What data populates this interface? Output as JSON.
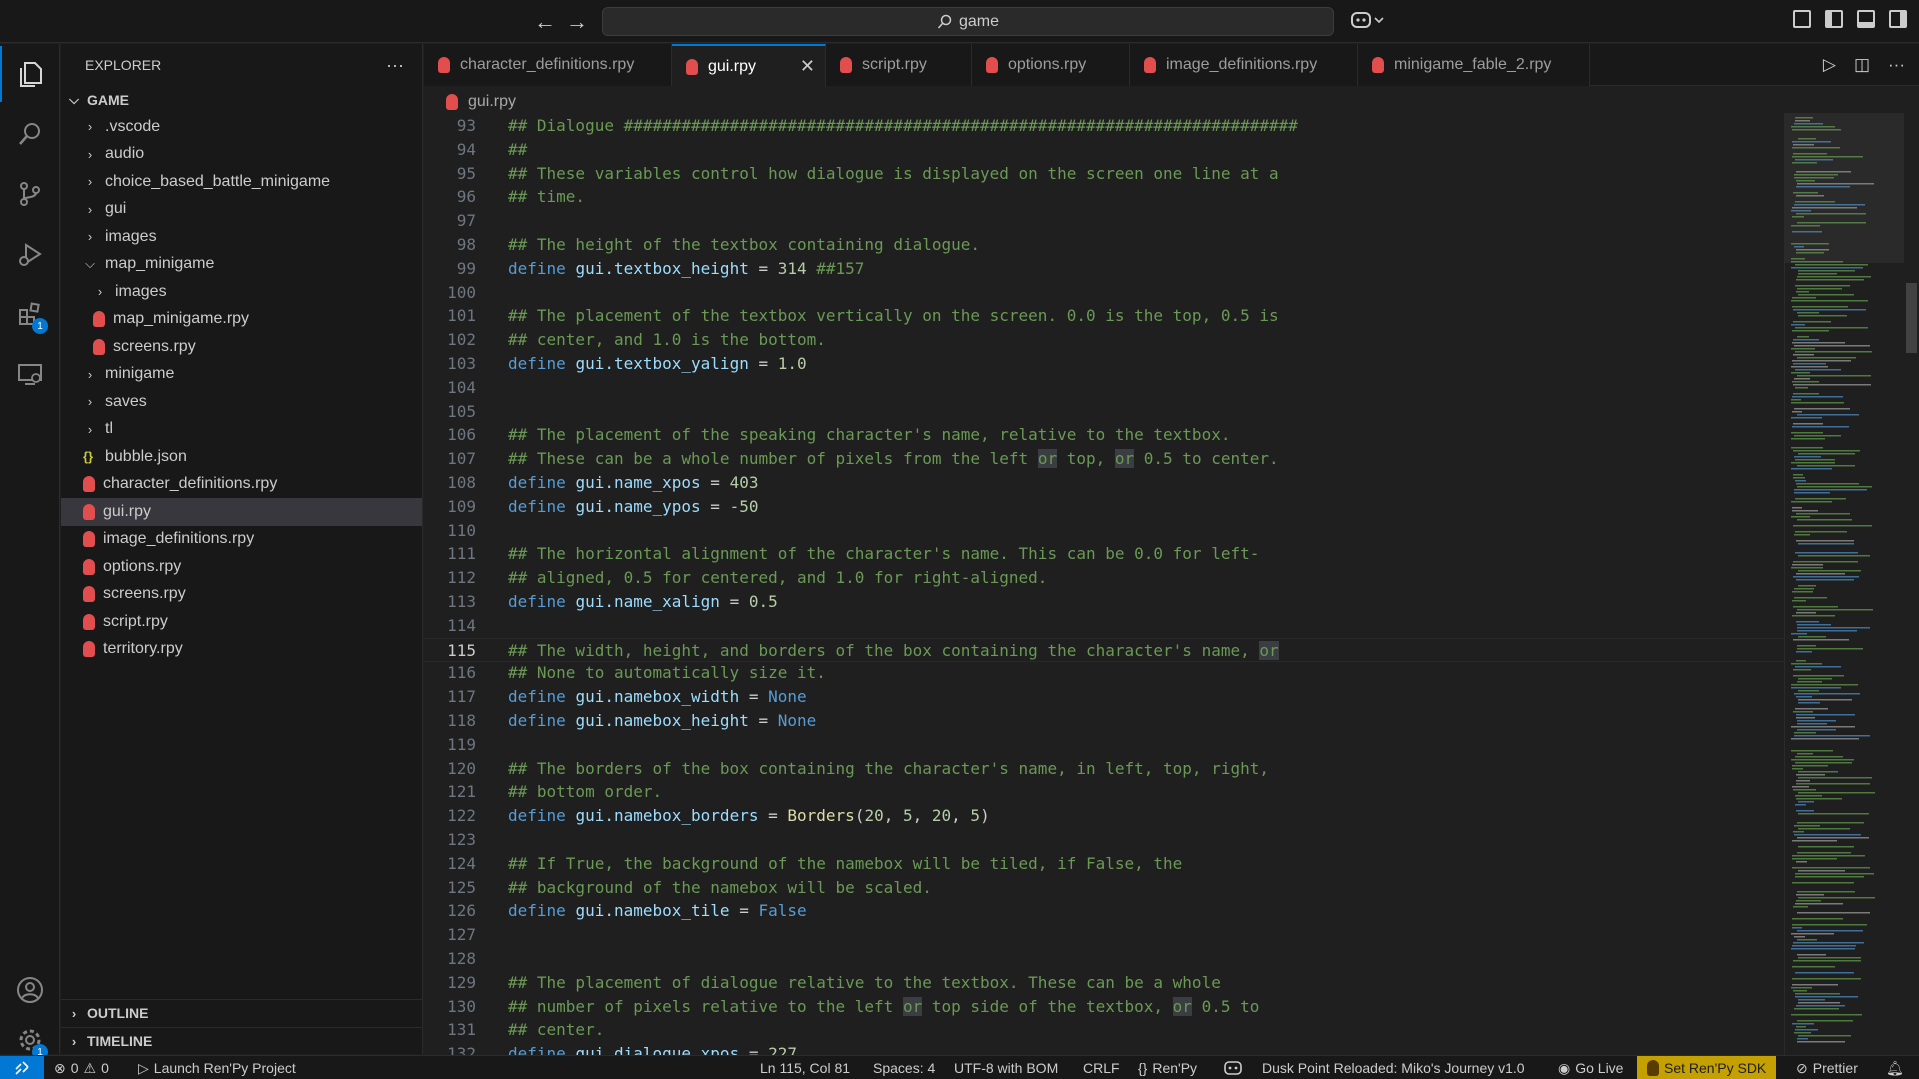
{
  "titlebar": {
    "back": "←",
    "forward": "→",
    "search_text": "game"
  },
  "explorer": {
    "title": "EXPLORER",
    "more": "···",
    "root": "GAME",
    "items": [
      {
        "label": ".vscode",
        "type": "folder",
        "open": false,
        "depth": 1
      },
      {
        "label": "audio",
        "type": "folder",
        "open": false,
        "depth": 1
      },
      {
        "label": "choice_based_battle_minigame",
        "type": "folder",
        "open": false,
        "depth": 1
      },
      {
        "label": "gui",
        "type": "folder",
        "open": false,
        "depth": 1
      },
      {
        "label": "images",
        "type": "folder",
        "open": false,
        "depth": 1
      },
      {
        "label": "map_minigame",
        "type": "folder",
        "open": true,
        "depth": 1
      },
      {
        "label": "images",
        "type": "folder",
        "open": false,
        "depth": 2
      },
      {
        "label": "map_minigame.rpy",
        "type": "rpy",
        "depth": 2
      },
      {
        "label": "screens.rpy",
        "type": "rpy",
        "depth": 2
      },
      {
        "label": "minigame",
        "type": "folder",
        "open": false,
        "depth": 1
      },
      {
        "label": "saves",
        "type": "folder",
        "open": false,
        "depth": 1
      },
      {
        "label": "tl",
        "type": "folder",
        "open": false,
        "depth": 1
      },
      {
        "label": "bubble.json",
        "type": "json",
        "depth": 1
      },
      {
        "label": "character_definitions.rpy",
        "type": "rpy",
        "depth": 1
      },
      {
        "label": "gui.rpy",
        "type": "rpy",
        "depth": 1,
        "selected": true
      },
      {
        "label": "image_definitions.rpy",
        "type": "rpy",
        "depth": 1
      },
      {
        "label": "options.rpy",
        "type": "rpy",
        "depth": 1
      },
      {
        "label": "screens.rpy",
        "type": "rpy",
        "depth": 1
      },
      {
        "label": "script.rpy",
        "type": "rpy",
        "depth": 1
      },
      {
        "label": "territory.rpy",
        "type": "rpy",
        "depth": 1
      }
    ],
    "outline": "OUTLINE",
    "timeline": "TIMELINE"
  },
  "activity": {
    "extensions_badge": "1",
    "settings_badge": "1"
  },
  "tabs": [
    {
      "label": "character_definitions.rpy",
      "active": false
    },
    {
      "label": "gui.rpy",
      "active": true
    },
    {
      "label": "script.rpy",
      "active": false
    },
    {
      "label": "options.rpy",
      "active": false
    },
    {
      "label": "image_definitions.rpy",
      "active": false
    },
    {
      "label": "minigame_fable_2.rpy",
      "active": false
    }
  ],
  "tab_close": "✕",
  "breadcrumb": "gui.rpy",
  "editor": {
    "current_line": 115,
    "lines": [
      {
        "n": 93,
        "segs": [
          [
            "cm",
            "## Dialogue ######################################################################"
          ]
        ]
      },
      {
        "n": 94,
        "segs": [
          [
            "cm",
            "##"
          ]
        ]
      },
      {
        "n": 95,
        "segs": [
          [
            "cm",
            "## These variables control how dialogue is displayed on the screen one line at a"
          ]
        ]
      },
      {
        "n": 96,
        "segs": [
          [
            "cm",
            "## time."
          ]
        ]
      },
      {
        "n": 97,
        "segs": []
      },
      {
        "n": 98,
        "segs": [
          [
            "cm",
            "## The height of the textbox containing dialogue."
          ]
        ]
      },
      {
        "n": 99,
        "segs": [
          [
            "kw",
            "define "
          ],
          [
            "id",
            "gui.textbox_height"
          ],
          [
            "",
            " = "
          ],
          [
            "nm",
            "314"
          ],
          [
            "cm",
            " ##157"
          ]
        ]
      },
      {
        "n": 100,
        "segs": []
      },
      {
        "n": 101,
        "segs": [
          [
            "cm",
            "## The placement of the textbox vertically on the screen. 0.0 is the top, 0.5 is"
          ]
        ]
      },
      {
        "n": 102,
        "segs": [
          [
            "cm",
            "## center, and 1.0 is the bottom."
          ]
        ]
      },
      {
        "n": 103,
        "segs": [
          [
            "kw",
            "define "
          ],
          [
            "id",
            "gui.textbox_yalign"
          ],
          [
            "",
            " = "
          ],
          [
            "nm",
            "1.0"
          ]
        ]
      },
      {
        "n": 104,
        "segs": []
      },
      {
        "n": 105,
        "segs": []
      },
      {
        "n": 106,
        "segs": [
          [
            "cm",
            "## The placement of the speaking character's name, relative to the textbox."
          ]
        ]
      },
      {
        "n": 107,
        "segs": [
          [
            "cm",
            "## These can be a whole number of pixels from the left "
          ],
          [
            "cm hl",
            "or"
          ],
          [
            "cm",
            " top, "
          ],
          [
            "cm hl",
            "or"
          ],
          [
            "cm",
            " 0.5 to center."
          ]
        ]
      },
      {
        "n": 108,
        "segs": [
          [
            "kw",
            "define "
          ],
          [
            "id",
            "gui.name_xpos"
          ],
          [
            "",
            " = "
          ],
          [
            "nm",
            "403"
          ]
        ]
      },
      {
        "n": 109,
        "segs": [
          [
            "kw",
            "define "
          ],
          [
            "id",
            "gui.name_ypos"
          ],
          [
            "",
            " = "
          ],
          [
            "nm",
            "-50"
          ]
        ]
      },
      {
        "n": 110,
        "segs": []
      },
      {
        "n": 111,
        "segs": [
          [
            "cm",
            "## The horizontal alignment of the character's name. This can be 0.0 for left-"
          ]
        ]
      },
      {
        "n": 112,
        "segs": [
          [
            "cm",
            "## aligned, 0.5 for centered, and 1.0 for right-aligned."
          ]
        ]
      },
      {
        "n": 113,
        "segs": [
          [
            "kw",
            "define "
          ],
          [
            "id",
            "gui.name_xalign"
          ],
          [
            "",
            " = "
          ],
          [
            "nm",
            "0.5"
          ]
        ]
      },
      {
        "n": 114,
        "segs": []
      },
      {
        "n": 115,
        "segs": [
          [
            "cm",
            "## The width, height, and borders of the box containing the character's name, "
          ],
          [
            "cm hl",
            "or"
          ]
        ]
      },
      {
        "n": 116,
        "segs": [
          [
            "cm",
            "## None to automatically size it."
          ]
        ]
      },
      {
        "n": 117,
        "segs": [
          [
            "kw",
            "define "
          ],
          [
            "id",
            "gui.namebox_width"
          ],
          [
            "",
            " = "
          ],
          [
            "kw",
            "None"
          ]
        ]
      },
      {
        "n": 118,
        "segs": [
          [
            "kw",
            "define "
          ],
          [
            "id",
            "gui.namebox_height"
          ],
          [
            "",
            " = "
          ],
          [
            "kw",
            "None"
          ]
        ]
      },
      {
        "n": 119,
        "segs": []
      },
      {
        "n": 120,
        "segs": [
          [
            "cm",
            "## The borders of the box containing the character's name, in left, top, right,"
          ]
        ]
      },
      {
        "n": 121,
        "segs": [
          [
            "cm",
            "## bottom order."
          ]
        ]
      },
      {
        "n": 122,
        "segs": [
          [
            "kw",
            "define "
          ],
          [
            "id",
            "gui.namebox_borders"
          ],
          [
            "",
            " = "
          ],
          [
            "fn",
            "Borders"
          ],
          [
            "",
            "("
          ],
          [
            "nm",
            "20"
          ],
          [
            "",
            ", "
          ],
          [
            "nm",
            "5"
          ],
          [
            "",
            ", "
          ],
          [
            "nm",
            "20"
          ],
          [
            "",
            ", "
          ],
          [
            "nm",
            "5"
          ],
          [
            "",
            ")"
          ]
        ]
      },
      {
        "n": 123,
        "segs": []
      },
      {
        "n": 124,
        "segs": [
          [
            "cm",
            "## If True, the background of the namebox will be tiled, if False, the"
          ]
        ]
      },
      {
        "n": 125,
        "segs": [
          [
            "cm",
            "## background of the namebox will be scaled."
          ]
        ]
      },
      {
        "n": 126,
        "segs": [
          [
            "kw",
            "define "
          ],
          [
            "id",
            "gui.namebox_tile"
          ],
          [
            "",
            " = "
          ],
          [
            "kw",
            "False"
          ]
        ]
      },
      {
        "n": 127,
        "segs": []
      },
      {
        "n": 128,
        "segs": []
      },
      {
        "n": 129,
        "segs": [
          [
            "cm",
            "## The placement of dialogue relative to the textbox. These can be a whole"
          ]
        ]
      },
      {
        "n": 130,
        "segs": [
          [
            "cm",
            "## number of pixels relative to the left "
          ],
          [
            "cm hl",
            "or"
          ],
          [
            "cm",
            " top side of the textbox, "
          ],
          [
            "cm hl",
            "or"
          ],
          [
            "cm",
            " 0.5 to"
          ]
        ]
      },
      {
        "n": 131,
        "segs": [
          [
            "cm",
            "## center."
          ]
        ]
      },
      {
        "n": 132,
        "segs": [
          [
            "kw",
            "define "
          ],
          [
            "id",
            "gui.dialogue_xpos"
          ],
          [
            "",
            " = "
          ],
          [
            "nm",
            "227"
          ]
        ]
      }
    ]
  },
  "status": {
    "remote": "⌁",
    "errors": "0",
    "warnings": "0",
    "launch": "Launch Ren'Py Project",
    "position": "Ln 115, Col 81",
    "spaces": "Spaces: 4",
    "encoding": "UTF-8 with BOM",
    "eol": "CRLF",
    "language": "Ren'Py",
    "project": "Dusk Point Reloaded: Miko's Journey v1.0",
    "golive": "Go Live",
    "sdk": "Set Ren'Py SDK",
    "prettier": "Prettier"
  }
}
